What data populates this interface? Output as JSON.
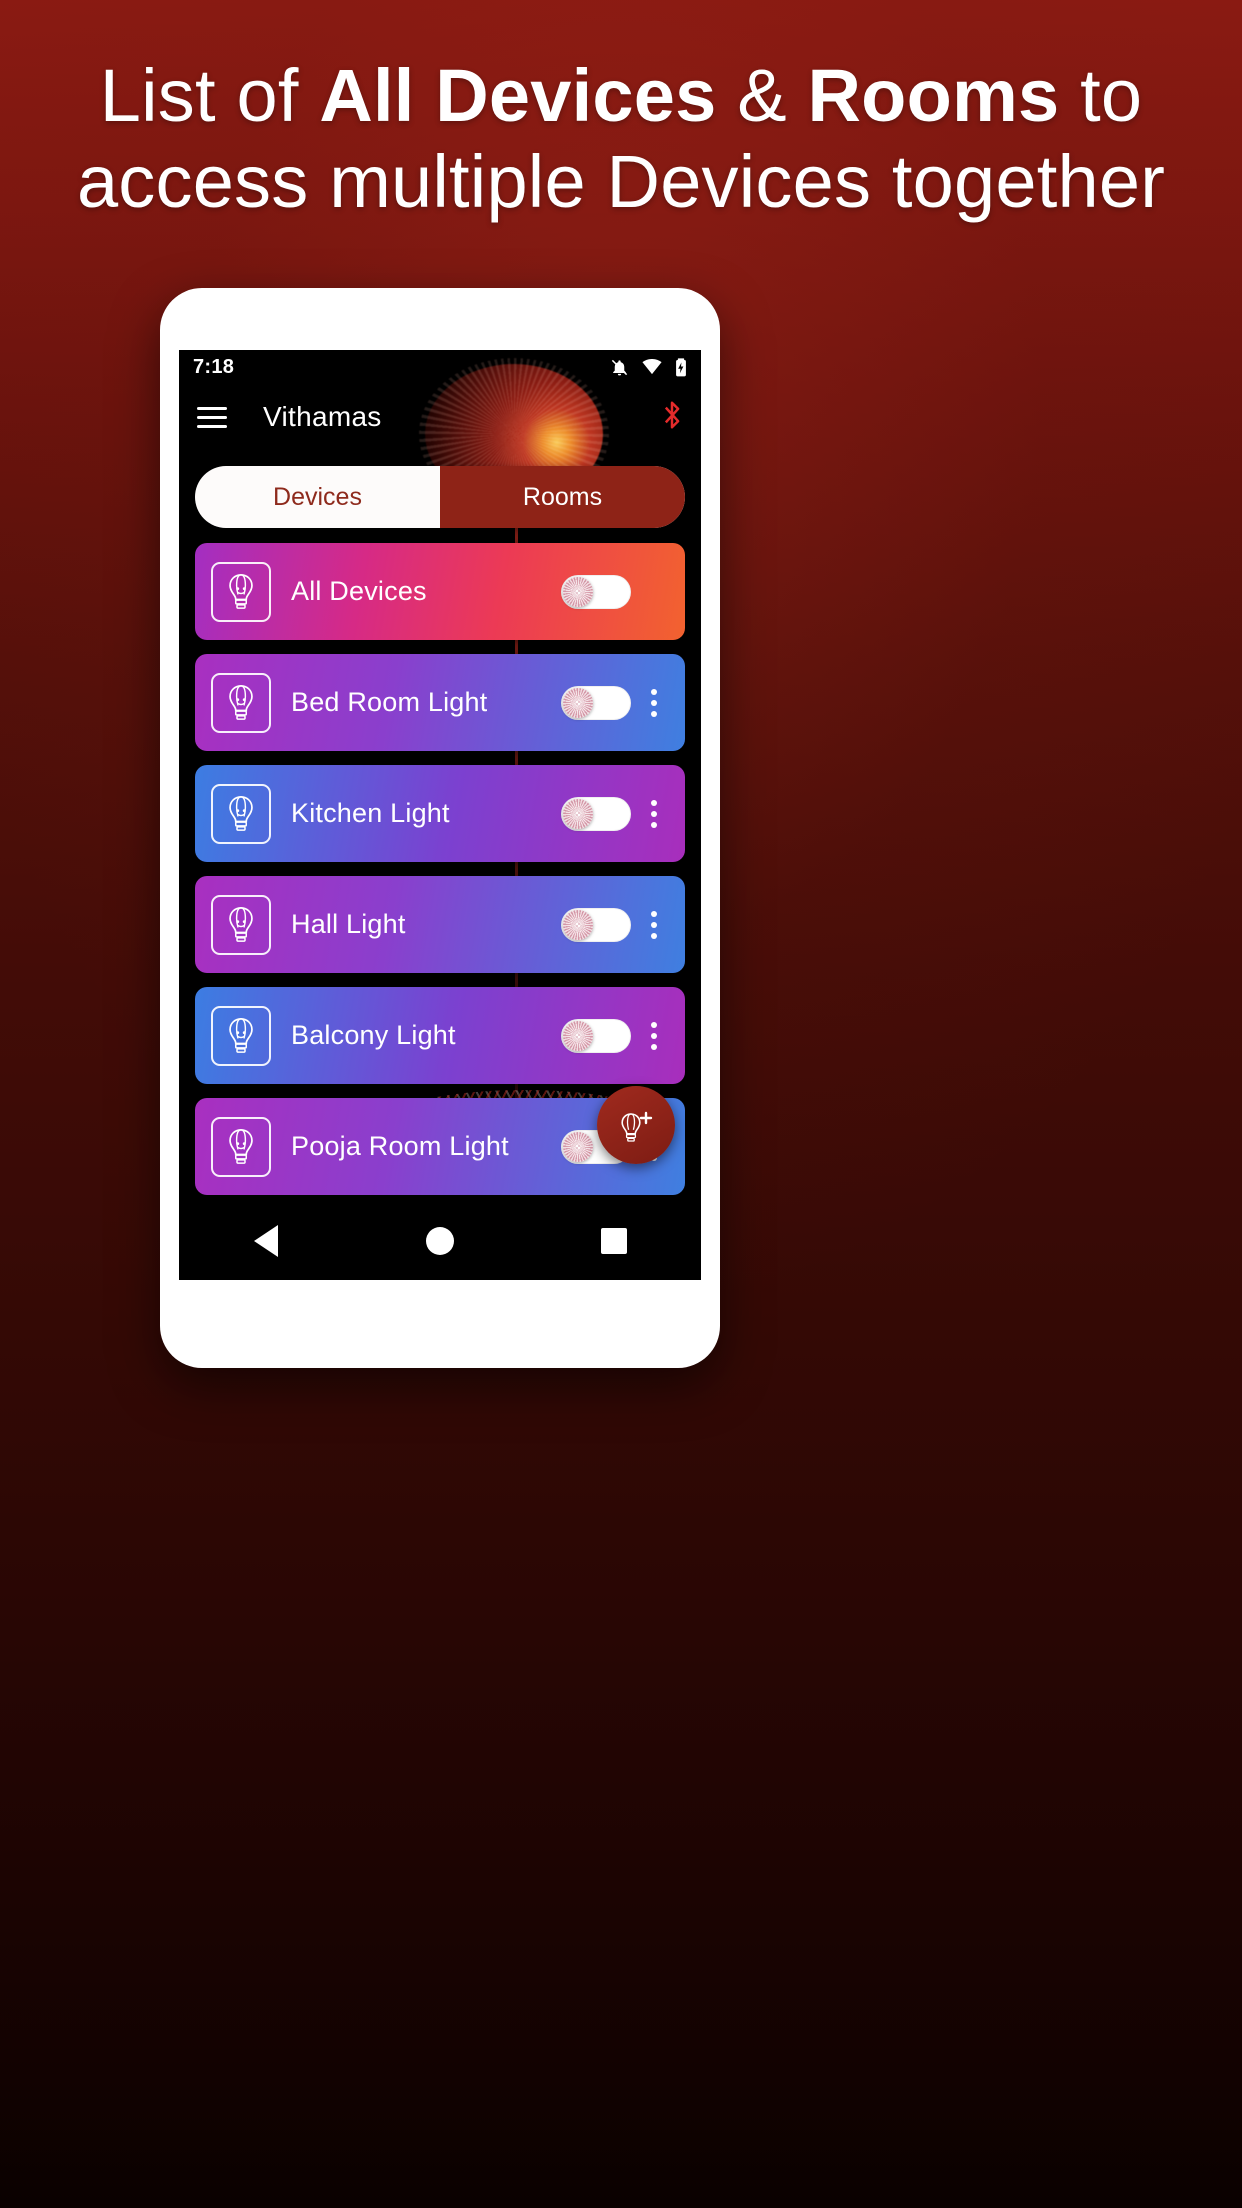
{
  "promo": {
    "headline_line1_pre": "List of ",
    "headline_line1_bold1": "All Devices",
    "headline_line1_mid": " & ",
    "headline_line1_bold2": "Rooms",
    "headline_line1_post": " to",
    "headline_line2": "access multiple Devices together",
    "background_top_color": "#8a1a12",
    "background_bottom_color": "#0a0100"
  },
  "phone": {
    "statusbar": {
      "time": "7:18",
      "icons": [
        "notifications-off-icon",
        "wifi-icon",
        "battery-charging-icon"
      ]
    },
    "appbar": {
      "menu_icon": "hamburger-menu-icon",
      "title": "Vithamas",
      "action_icon": "bluetooth-icon",
      "action_icon_color": "#e52b2b"
    },
    "tabs": {
      "active_index": 1,
      "items": [
        {
          "label": "Devices",
          "active": false
        },
        {
          "label": "Rooms",
          "active": true
        }
      ],
      "active_bg": "#8e2317",
      "inactive_text": "#8e2a1c",
      "track_bg": "#fdfbfa"
    },
    "devices": [
      {
        "label": "All Devices",
        "icon": "bulb-icon",
        "toggle_on": false,
        "has_menu": false,
        "gradient": "g-all"
      },
      {
        "label": "Bed Room Light",
        "icon": "bulb-icon",
        "toggle_on": false,
        "has_menu": true,
        "gradient": "g-a"
      },
      {
        "label": "Kitchen Light",
        "icon": "bulb-icon",
        "toggle_on": false,
        "has_menu": true,
        "gradient": "g-b"
      },
      {
        "label": "Hall Light",
        "icon": "bulb-icon",
        "toggle_on": false,
        "has_menu": true,
        "gradient": "g-a"
      },
      {
        "label": "Balcony Light",
        "icon": "bulb-icon",
        "toggle_on": false,
        "has_menu": true,
        "gradient": "g-b"
      },
      {
        "label": "Pooja Room Light",
        "icon": "bulb-icon",
        "toggle_on": false,
        "has_menu": true,
        "gradient": "g-a"
      }
    ],
    "fab": {
      "icon": "add-bulb-icon",
      "color": "#8e2317"
    },
    "navbar": {
      "back": "back-triangle-icon",
      "home": "home-circle-icon",
      "recents": "recents-square-icon"
    }
  }
}
